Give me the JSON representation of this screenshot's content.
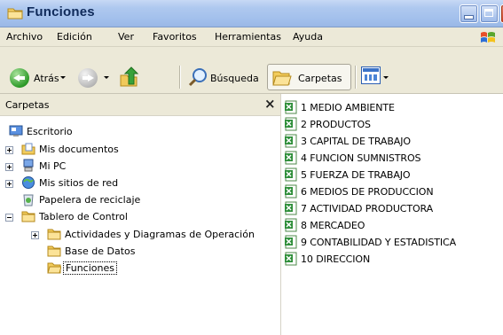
{
  "window": {
    "title": "Funciones",
    "colors": {
      "titlebar": "#a3c0ec",
      "menubar": "#ece9d8",
      "close": "#c8401f"
    }
  },
  "menu": [
    {
      "label": "Archivo"
    },
    {
      "label": "Edición"
    },
    {
      "label": "Ver"
    },
    {
      "label": "Favoritos"
    },
    {
      "label": "Herramientas"
    },
    {
      "label": "Ayuda"
    }
  ],
  "toolbar": {
    "back_label": "Atrás",
    "search_label": "Búsqueda",
    "folders_label": "Carpetas",
    "icons": [
      "back-arrow-icon",
      "forward-arrow-icon",
      "folder-up-icon",
      "search-icon",
      "folders-icon",
      "views-icon"
    ]
  },
  "left_pane": {
    "title": "Carpetas",
    "close_glyph": "×",
    "tree": [
      {
        "label": "Escritorio",
        "icon": "desktop-icon"
      },
      {
        "label": "Mis documentos",
        "icon": "documents-folder-icon",
        "expander": "+"
      },
      {
        "label": "Mi PC",
        "icon": "computer-icon",
        "expander": "+"
      },
      {
        "label": "Mis sitios de red",
        "icon": "network-icon",
        "expander": "+"
      },
      {
        "label": "Papelera de reciclaje",
        "icon": "recycle-bin-icon"
      },
      {
        "label": "Tablero de Control",
        "icon": "folder-icon",
        "expander": "-"
      },
      {
        "label": "Actividades y Diagramas de Operación",
        "icon": "folder-icon",
        "expander": "+"
      },
      {
        "label": "Base de Datos",
        "icon": "folder-icon"
      },
      {
        "label": "Funciones",
        "icon": "open-folder-icon",
        "selected": true
      }
    ]
  },
  "right_pane": {
    "files": [
      {
        "name": "1 MEDIO AMBIENTE",
        "icon": "excel-file-icon"
      },
      {
        "name": "2 PRODUCTOS",
        "icon": "excel-file-icon"
      },
      {
        "name": "3 CAPITAL DE TRABAJO",
        "icon": "excel-file-icon"
      },
      {
        "name": "4 FUNCION SUMNISTROS",
        "icon": "excel-file-icon"
      },
      {
        "name": "5 FUERZA DE TRABAJO",
        "icon": "excel-file-icon"
      },
      {
        "name": "6 MEDIOS DE PRODUCCION",
        "icon": "excel-file-icon"
      },
      {
        "name": "7 ACTIVIDAD PRODUCTORA",
        "icon": "excel-file-icon"
      },
      {
        "name": "8 MERCADEO",
        "icon": "excel-file-icon"
      },
      {
        "name": "9 CONTABILIDAD Y ESTADISTICA",
        "icon": "excel-file-icon"
      },
      {
        "name": "10 DIRECCION",
        "icon": "excel-file-icon"
      }
    ]
  }
}
